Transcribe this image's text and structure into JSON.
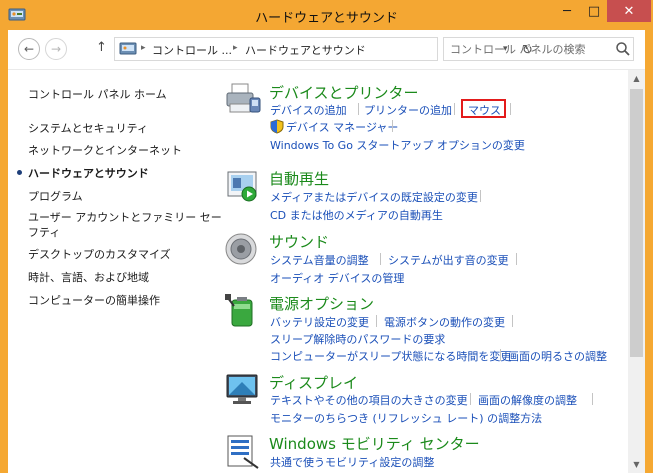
{
  "window": {
    "title": "ハードウェアとサウンド",
    "min_glyph": "─",
    "max_glyph": "□",
    "close_glyph": "✕"
  },
  "address": {
    "back_glyph": "←",
    "forward_glyph": "→",
    "up_glyph": "↑",
    "crumbs": [
      "コントロール ...",
      "ハードウェアとサウンド"
    ],
    "crumb_sep": "▸",
    "dropdown_glyph": "▾",
    "refresh_glyph": "↻"
  },
  "search": {
    "placeholder": "コントロール パネルの検索"
  },
  "sidebar": {
    "items": [
      "コントロール パネル ホーム",
      "システムとセキュリティ",
      "ネットワークとインターネット",
      "ハードウェアとサウンド",
      "プログラム",
      "ユーザー アカウントとファミリー セーフティ",
      "デスクトップのカスタマイズ",
      "時計、言語、および地域",
      "コンピューターの簡単操作"
    ],
    "item_line2": "フティ",
    "current_index": 3
  },
  "categories": {
    "devices": {
      "title": "デバイスとプリンター",
      "links": [
        "デバイスの追加",
        "プリンターの追加",
        "マウス",
        "デバイス マネージャー",
        "Windows To Go スタートアップ オプションの変更"
      ]
    },
    "autoplay": {
      "title": "自動再生",
      "links": [
        "メディアまたはデバイスの既定設定の変更",
        "CD または他のメディアの自動再生"
      ]
    },
    "sound": {
      "title": "サウンド",
      "links": [
        "システム音量の調整",
        "システムが出す音の変更",
        "オーディオ デバイスの管理"
      ]
    },
    "power": {
      "title": "電源オプション",
      "links": [
        "バッテリ設定の変更",
        "電源ボタンの動作の変更",
        "スリープ解除時のパスワードの要求",
        "コンピューターがスリープ状態になる時間を変更",
        "画面の明るさの調整"
      ]
    },
    "display": {
      "title": "ディスプレイ",
      "links": [
        "テキストやその他の項目の大きさの変更",
        "画面の解像度の調整",
        "モニターのちらつき (リフレッシュ レート) の調整方法"
      ]
    },
    "mobility": {
      "title": "Windows モビリティ センター",
      "links": [
        "共通で使うモビリティ設定の調整"
      ]
    }
  },
  "colors": {
    "title_bar": "#f4a733",
    "category_title": "#1b8a1b",
    "link": "#1a4fb8",
    "highlight_box": "#e31b1b"
  }
}
